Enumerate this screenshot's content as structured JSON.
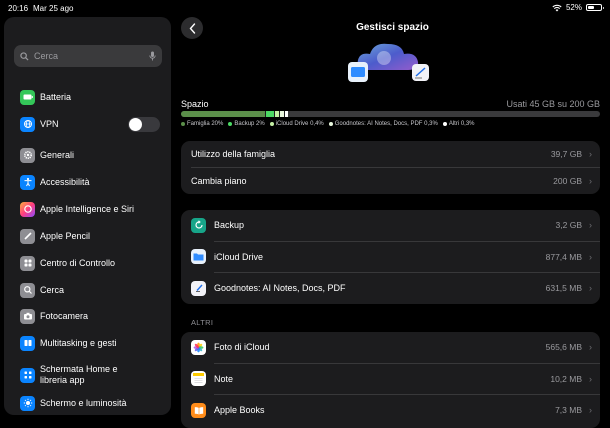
{
  "status": {
    "time": "20:16",
    "date": "Mar 25 ago",
    "battery": "52%",
    "battery_level": 0.52
  },
  "sidebar": {
    "search_placeholder": "Cerca",
    "items": [
      {
        "label": "Batteria",
        "icon": "battery-icon",
        "color": "#34c759"
      },
      {
        "label": "VPN",
        "icon": "vpn-icon",
        "color": "#0a84ff",
        "toggle": false
      },
      {
        "label": "Generali",
        "icon": "gear-icon",
        "color": "#8e8e93"
      },
      {
        "label": "Accessibilità",
        "icon": "accessibility-icon",
        "color": "#0a84ff"
      },
      {
        "label": "Apple Intelligence e Siri",
        "icon": "siri-icon",
        "color": "#ff6b3d"
      },
      {
        "label": "Apple Pencil",
        "icon": "pencil-icon",
        "color": "#8e8e93"
      },
      {
        "label": "Centro di Controllo",
        "icon": "control-center-icon",
        "color": "#8e8e93"
      },
      {
        "label": "Cerca",
        "icon": "search-icon",
        "color": "#8e8e93"
      },
      {
        "label": "Fotocamera",
        "icon": "camera-icon",
        "color": "#8e8e93"
      },
      {
        "label": "Multitasking e gesti",
        "icon": "multitasking-icon",
        "color": "#0a84ff"
      },
      {
        "label": "Schermata Home e libreria app",
        "icon": "home-screen-icon",
        "color": "#0a84ff"
      },
      {
        "label": "Schermo e luminosità",
        "icon": "brightness-icon",
        "color": "#0a84ff"
      }
    ]
  },
  "header": {
    "title": "Gestisci spazio"
  },
  "storage": {
    "label": "Spazio",
    "used": "Usati 45 GB su 200 GB",
    "segments": [
      {
        "name": "Famiglia",
        "pct": 20,
        "label": "Famiglia 20%",
        "color": "#5b8f4a"
      },
      {
        "name": "Backup",
        "pct": 2,
        "label": "Backup 2%",
        "color": "#4cd964"
      },
      {
        "name": "iCloud Drive",
        "pct": 0.4,
        "label": "iCloud Drive 0,4%",
        "color": "#c5f0a4"
      },
      {
        "name": "Goodnotes",
        "pct": 0.3,
        "label": "Goodnotes: AI Notes, Docs, PDF 0,3%",
        "color": "#e8f7dd"
      },
      {
        "name": "Altri",
        "pct": 0.3,
        "label": "Altri 0,3%",
        "color": "#ffffff"
      }
    ]
  },
  "plan": {
    "rows": [
      {
        "label": "Utilizzo della famiglia",
        "value": "39,7 GB"
      },
      {
        "label": "Cambia piano",
        "value": "200 GB"
      }
    ]
  },
  "apps": {
    "rows": [
      {
        "label": "Backup",
        "value": "3,2 GB",
        "icon": "backup-icon",
        "color": "#17a589"
      },
      {
        "label": "iCloud Drive",
        "value": "877,4 MB",
        "icon": "folder-icon",
        "color": "#e8f1fb"
      },
      {
        "label": "Goodnotes: AI Notes, Docs, PDF",
        "value": "631,5 MB",
        "icon": "goodnotes-icon",
        "color": "#f2f2f7"
      }
    ]
  },
  "others": {
    "title": "ALTRI",
    "rows": [
      {
        "label": "Foto di iCloud",
        "value": "565,6 MB",
        "icon": "photos-icon",
        "color": "#ffffff"
      },
      {
        "label": "Note",
        "value": "10,2 MB",
        "icon": "notes-icon",
        "color": "#ffffff"
      },
      {
        "label": "Apple Books",
        "value": "7,3 MB",
        "icon": "books-icon",
        "color": "#ff8c1a"
      }
    ]
  }
}
